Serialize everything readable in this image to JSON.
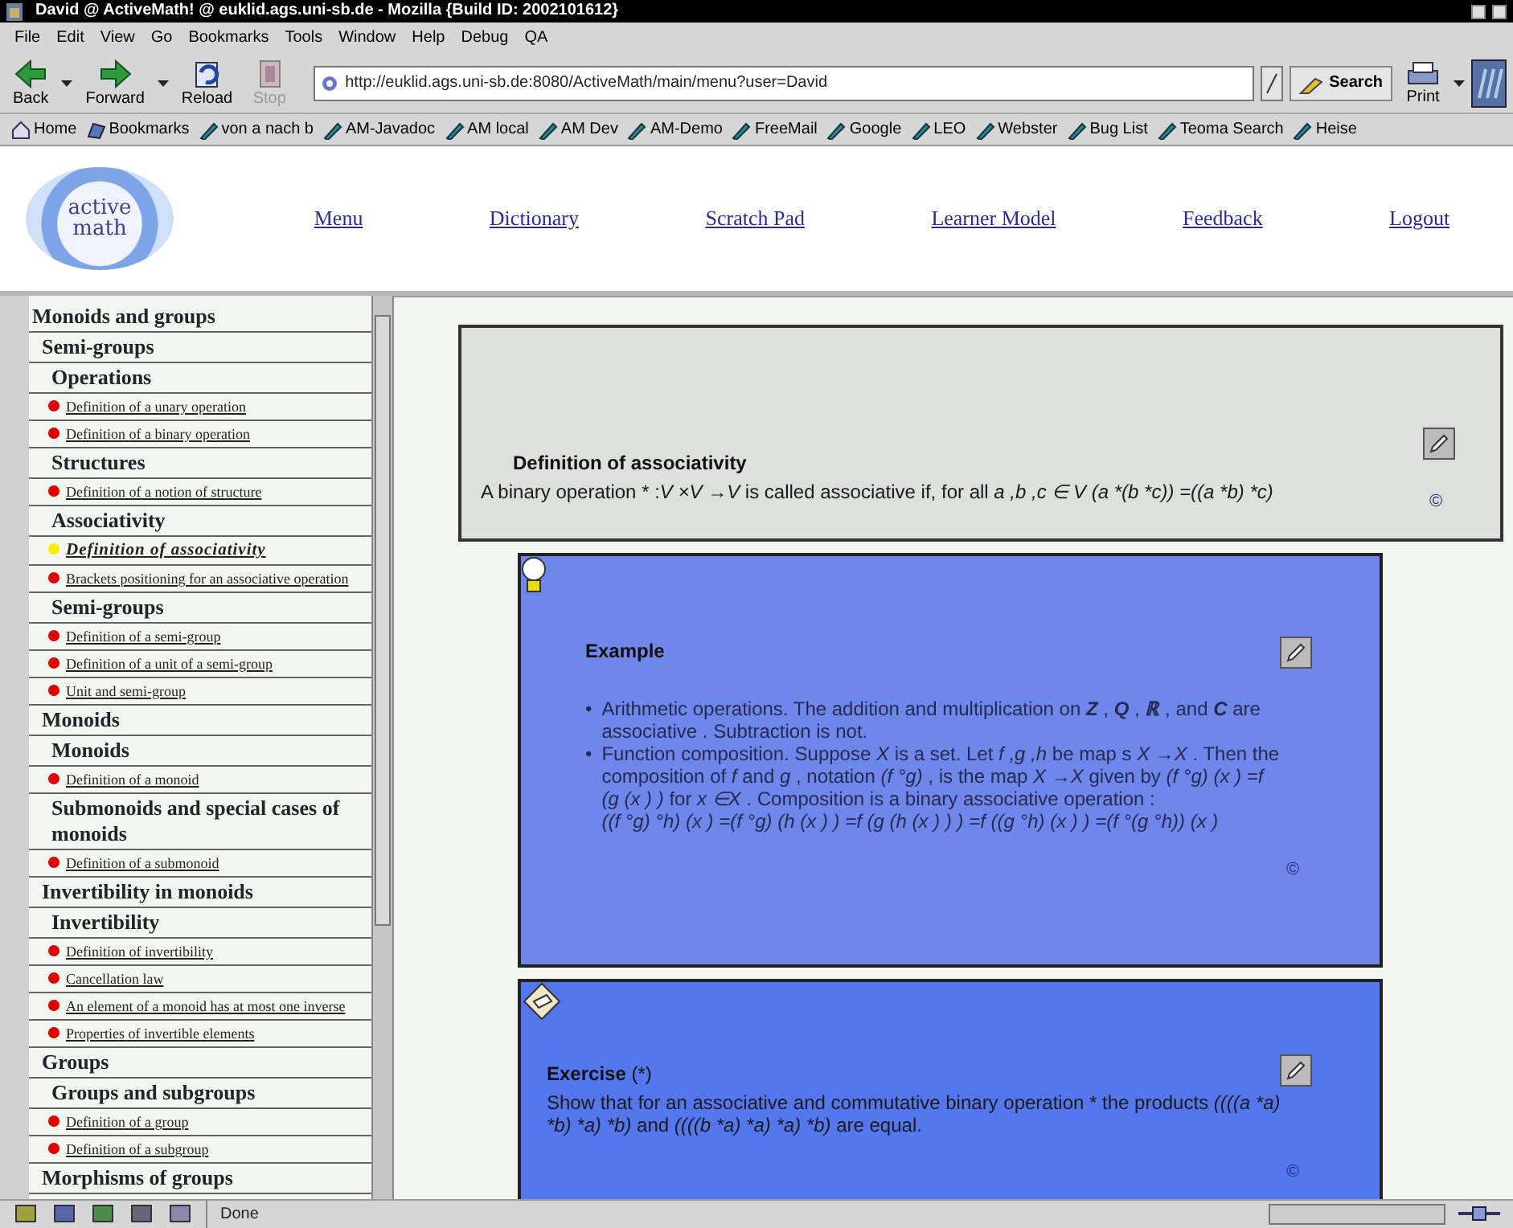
{
  "window": {
    "title": "David @ ActiveMath! @ euklid.ags.uni-sb.de - Mozilla {Build ID: 2002101612}"
  },
  "menu": [
    "File",
    "Edit",
    "View",
    "Go",
    "Bookmarks",
    "Tools",
    "Window",
    "Help",
    "Debug",
    "QA"
  ],
  "toolbar": {
    "buttons": [
      {
        "label": "Back",
        "kind": "back",
        "dropdown": true,
        "disabled": false
      },
      {
        "label": "Forward",
        "kind": "forward",
        "dropdown": true,
        "disabled": false
      },
      {
        "label": "Reload",
        "kind": "reload",
        "dropdown": false,
        "disabled": false
      },
      {
        "label": "Stop",
        "kind": "stop",
        "dropdown": false,
        "disabled": true
      }
    ],
    "url": "http://euklid.ags.uni-sb.de:8080/ActiveMath/main/menu?user=David",
    "search": "Search",
    "print": {
      "label": "Print",
      "dropdown": true
    }
  },
  "bookmarks": [
    {
      "label": "Home",
      "kind": "home"
    },
    {
      "label": "Bookmarks",
      "kind": "folder"
    },
    {
      "label": "von a nach b",
      "kind": "link"
    },
    {
      "label": "AM-Javadoc",
      "kind": "link"
    },
    {
      "label": "AM local",
      "kind": "link"
    },
    {
      "label": "AM Dev",
      "kind": "link"
    },
    {
      "label": "AM-Demo",
      "kind": "link"
    },
    {
      "label": "FreeMail",
      "kind": "link"
    },
    {
      "label": "Google",
      "kind": "link"
    },
    {
      "label": "LEO",
      "kind": "link"
    },
    {
      "label": "Webster",
      "kind": "link"
    },
    {
      "label": "Bug List",
      "kind": "link"
    },
    {
      "label": "Teoma Search",
      "kind": "link"
    },
    {
      "label": "Heise",
      "kind": "link"
    }
  ],
  "header": {
    "logo": [
      "active",
      "math"
    ],
    "nav": [
      "Menu",
      "Dictionary",
      "Scratch Pad",
      "Learner Model",
      "Feedback",
      "Logout"
    ]
  },
  "tree": [
    {
      "label": "Monoids and groups",
      "kind": "section",
      "children": [
        {
          "label": "Semi-groups",
          "kind": "section",
          "children": [
            {
              "label": "Operations",
              "kind": "section",
              "children": [
                {
                  "label": "Definition of a unary operation",
                  "kind": "item",
                  "color": "#e00000",
                  "selected": false
                },
                {
                  "label": "Definition of a binary operation",
                  "kind": "item",
                  "color": "#e00000",
                  "selected": false
                }
              ]
            },
            {
              "label": "Structures",
              "kind": "section",
              "children": [
                {
                  "label": "Definition of a notion of structure",
                  "kind": "item",
                  "color": "#e00000",
                  "selected": false
                }
              ]
            },
            {
              "label": "Associativity",
              "kind": "section",
              "children": [
                {
                  "label": "Definition of associativity",
                  "kind": "item",
                  "color": "#f0f000",
                  "selected": true
                },
                {
                  "label": "Brackets positioning for an associative operation",
                  "kind": "item",
                  "color": "#e00000",
                  "selected": false
                }
              ]
            },
            {
              "label": "Semi-groups",
              "kind": "section",
              "children": [
                {
                  "label": "Definition of a semi-group",
                  "kind": "item",
                  "color": "#e00000",
                  "selected": false
                },
                {
                  "label": "Definition of a unit of a semi-group",
                  "kind": "item",
                  "color": "#e00000",
                  "selected": false
                },
                {
                  "label": "Unit and semi-group",
                  "kind": "item",
                  "color": "#e00000",
                  "selected": false
                }
              ]
            }
          ]
        },
        {
          "label": "Monoids",
          "kind": "section",
          "children": [
            {
              "label": "Monoids",
              "kind": "section",
              "children": [
                {
                  "label": "Definition of a monoid",
                  "kind": "item",
                  "color": "#e00000",
                  "selected": false
                }
              ]
            },
            {
              "label": "Submonoids and special cases of monoids",
              "kind": "section",
              "children": [
                {
                  "label": "Definition of a submonoid",
                  "kind": "item",
                  "color": "#e00000",
                  "selected": false
                }
              ]
            }
          ]
        },
        {
          "label": "Invertibility in monoids",
          "kind": "section",
          "children": [
            {
              "label": "Invertibility",
              "kind": "section",
              "children": [
                {
                  "label": "Definition of invertibility",
                  "kind": "item",
                  "color": "#e00000",
                  "selected": false
                },
                {
                  "label": "Cancellation law",
                  "kind": "item",
                  "color": "#e00000",
                  "selected": false
                },
                {
                  "label": "An element of a monoid has at most one inverse",
                  "kind": "item",
                  "color": "#e00000",
                  "selected": false
                },
                {
                  "label": "Properties of invertible elements",
                  "kind": "item",
                  "color": "#e00000",
                  "selected": false
                }
              ]
            }
          ]
        },
        {
          "label": "Groups",
          "kind": "section",
          "children": [
            {
              "label": "Groups and subgroups",
              "kind": "section",
              "children": [
                {
                  "label": "Definition of a group",
                  "kind": "item",
                  "color": "#e00000",
                  "selected": false
                },
                {
                  "label": "Definition of a subgroup",
                  "kind": "item",
                  "color": "#e00000",
                  "selected": false
                }
              ]
            }
          ]
        },
        {
          "label": "Morphisms of groups",
          "kind": "section"
        }
      ]
    }
  ],
  "cards": [
    {
      "kind": "definition",
      "title": "Definition of associativity",
      "paragraphs": [
        [
          {
            "text": "A binary operation * :",
            "kind": "text"
          },
          {
            "text": "V ×V →V",
            "kind": "math"
          },
          {
            "text": " is called associative if, for all ",
            "kind": "text"
          },
          {
            "text": "a ,b ,c ∈ V (a *(b *c)) =((a *b) *c)",
            "kind": "math"
          }
        ]
      ],
      "mark": "©"
    },
    {
      "kind": "example",
      "title": "Example",
      "bullets": [
        {
          "marker": "•",
          "lines": [
            [
              {
                "text": "Arithmetic operations. The addition and multiplication on ",
                "kind": "text"
              },
              {
                "text": "Z",
                "kind": "set"
              },
              {
                "text": " , ",
                "kind": "text"
              },
              {
                "text": "Q",
                "kind": "set"
              },
              {
                "text": " , ",
                "kind": "text"
              },
              {
                "text": "ℝ",
                "kind": "set"
              },
              {
                "text": " , and ",
                "kind": "text"
              },
              {
                "text": "C",
                "kind": "set"
              },
              {
                "text": " are associative . Subtraction is not.",
                "kind": "text"
              }
            ]
          ]
        },
        {
          "marker": "•",
          "lines": [
            [
              {
                "text": "Function composition. Suppose ",
                "kind": "text"
              },
              {
                "text": "X",
                "kind": "math"
              },
              {
                "text": " is a set. Let ",
                "kind": "text"
              },
              {
                "text": "f ,g ,h",
                "kind": "math"
              },
              {
                "text": " be map s ",
                "kind": "text"
              },
              {
                "text": "X →X",
                "kind": "math"
              },
              {
                "text": " . Then the composition of ",
                "kind": "text"
              },
              {
                "text": "f",
                "kind": "math"
              },
              {
                "text": " and ",
                "kind": "text"
              },
              {
                "text": "g",
                "kind": "math"
              },
              {
                "text": " , notation ",
                "kind": "text"
              },
              {
                "text": "(f °g)",
                "kind": "math"
              },
              {
                "text": " , is the map ",
                "kind": "text"
              },
              {
                "text": "X →X",
                "kind": "math"
              },
              {
                "text": " given by ",
                "kind": "text"
              },
              {
                "text": "(f °g) (x ) =f (g (x ) )",
                "kind": "math"
              },
              {
                "text": " for ",
                "kind": "text"
              },
              {
                "text": "x ∈X",
                "kind": "math"
              },
              {
                "text": " . Composition is a binary associative operation :",
                "kind": "text"
              }
            ],
            [
              {
                "text": "((f °g) °h) (x ) =(f °g) (h (x ) ) =f (g (h (x ) ) ) =f ((g °h) (x ) ) =(f °(g °h)) (x )",
                "kind": "math"
              }
            ]
          ]
        }
      ],
      "mark": "©"
    },
    {
      "kind": "exercise",
      "title": "Exercise",
      "note": "(*)",
      "paragraphs": [
        [
          {
            "text": "Show that for an associative and commutative binary operation * the products ",
            "kind": "text"
          },
          {
            "text": "((((a *a) *b) *a) *b)",
            "kind": "math"
          },
          {
            "text": " and ",
            "kind": "text"
          },
          {
            "text": "((((b *a) *a) *a) *b)",
            "kind": "math"
          },
          {
            "text": " are equal.",
            "kind": "text"
          }
        ]
      ],
      "mark": "©"
    }
  ],
  "status": "Done"
}
